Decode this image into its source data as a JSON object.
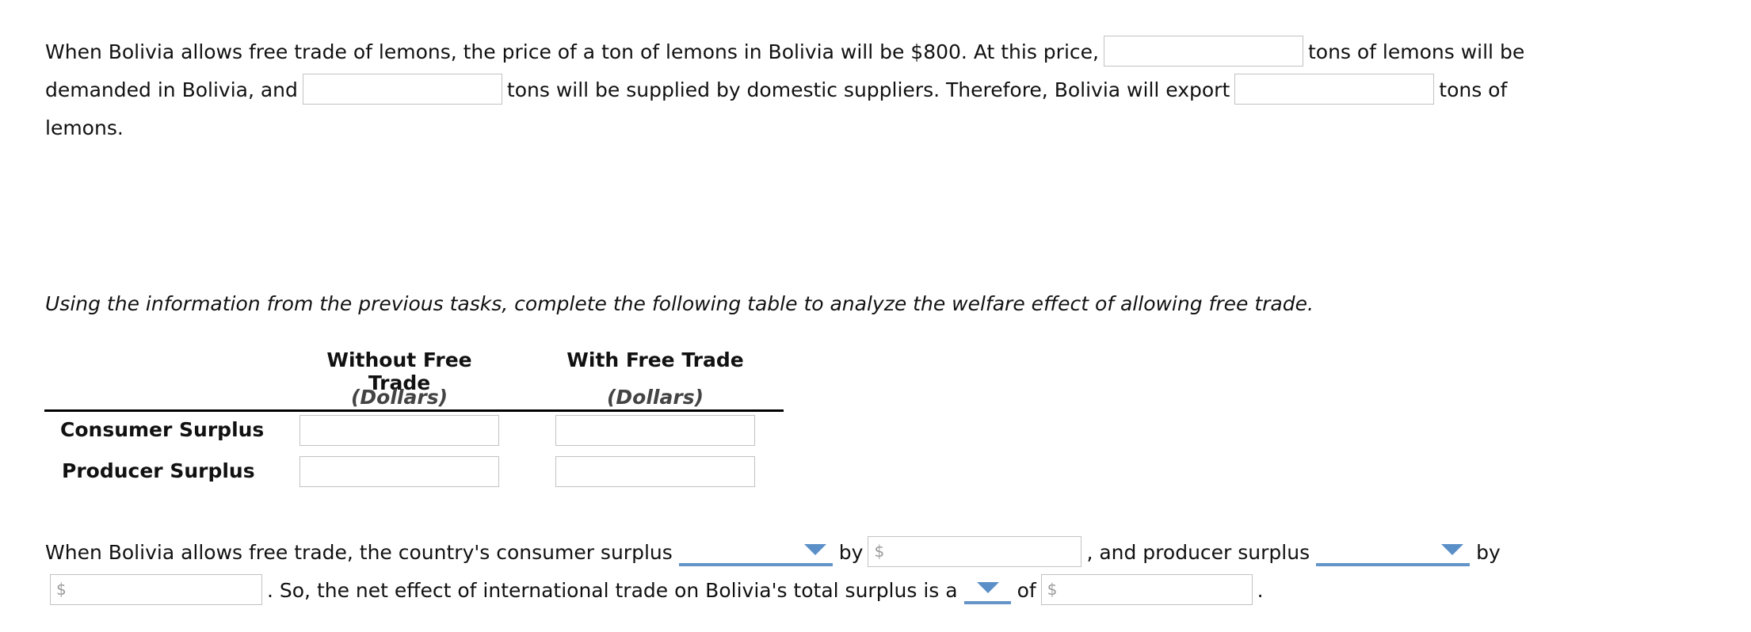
{
  "paragraph1": {
    "s1": "When Bolivia allows free trade of lemons, the price of a ton of lemons in Bolivia will be $800. At this price,",
    "s2": "tons of lemons will be",
    "s3": "demanded in Bolivia, and",
    "s4": "tons will be supplied by domestic suppliers. Therefore, Bolivia will export",
    "s5": "tons of",
    "s6": "lemons.",
    "inputs": {
      "quantity_demanded": "",
      "quantity_supplied": "",
      "exports": ""
    }
  },
  "instructions": "Using the information from the previous tasks, complete the following table to analyze the welfare effect of allowing free trade.",
  "table": {
    "columns": [
      {
        "header": "Without Free Trade",
        "unit": "(Dollars)"
      },
      {
        "header": "With Free Trade",
        "unit": "(Dollars)"
      }
    ],
    "rows": [
      {
        "label": "Consumer Surplus",
        "values": [
          "",
          ""
        ]
      },
      {
        "label": "Producer Surplus",
        "values": [
          "",
          ""
        ]
      }
    ]
  },
  "summary": {
    "t1": "When Bolivia allows free trade, the country's consumer surplus",
    "t2": "by",
    "t3": ", and producer surplus",
    "t4": "by",
    "t5": ". So, the net effect of international trade on Bolivia's total surplus is a",
    "t6": "of",
    "t7": ".",
    "currency_symbol": "$",
    "dropdowns": {
      "consumer_surplus_change": "",
      "producer_surplus_change": "",
      "net_effect_type": ""
    },
    "inputs": {
      "consumer_surplus_amount": "",
      "producer_surplus_amount": "",
      "net_effect_amount": ""
    }
  },
  "colors": {
    "dropdown_accent": "#5b8fc7",
    "input_border": "#c2c2c2"
  }
}
